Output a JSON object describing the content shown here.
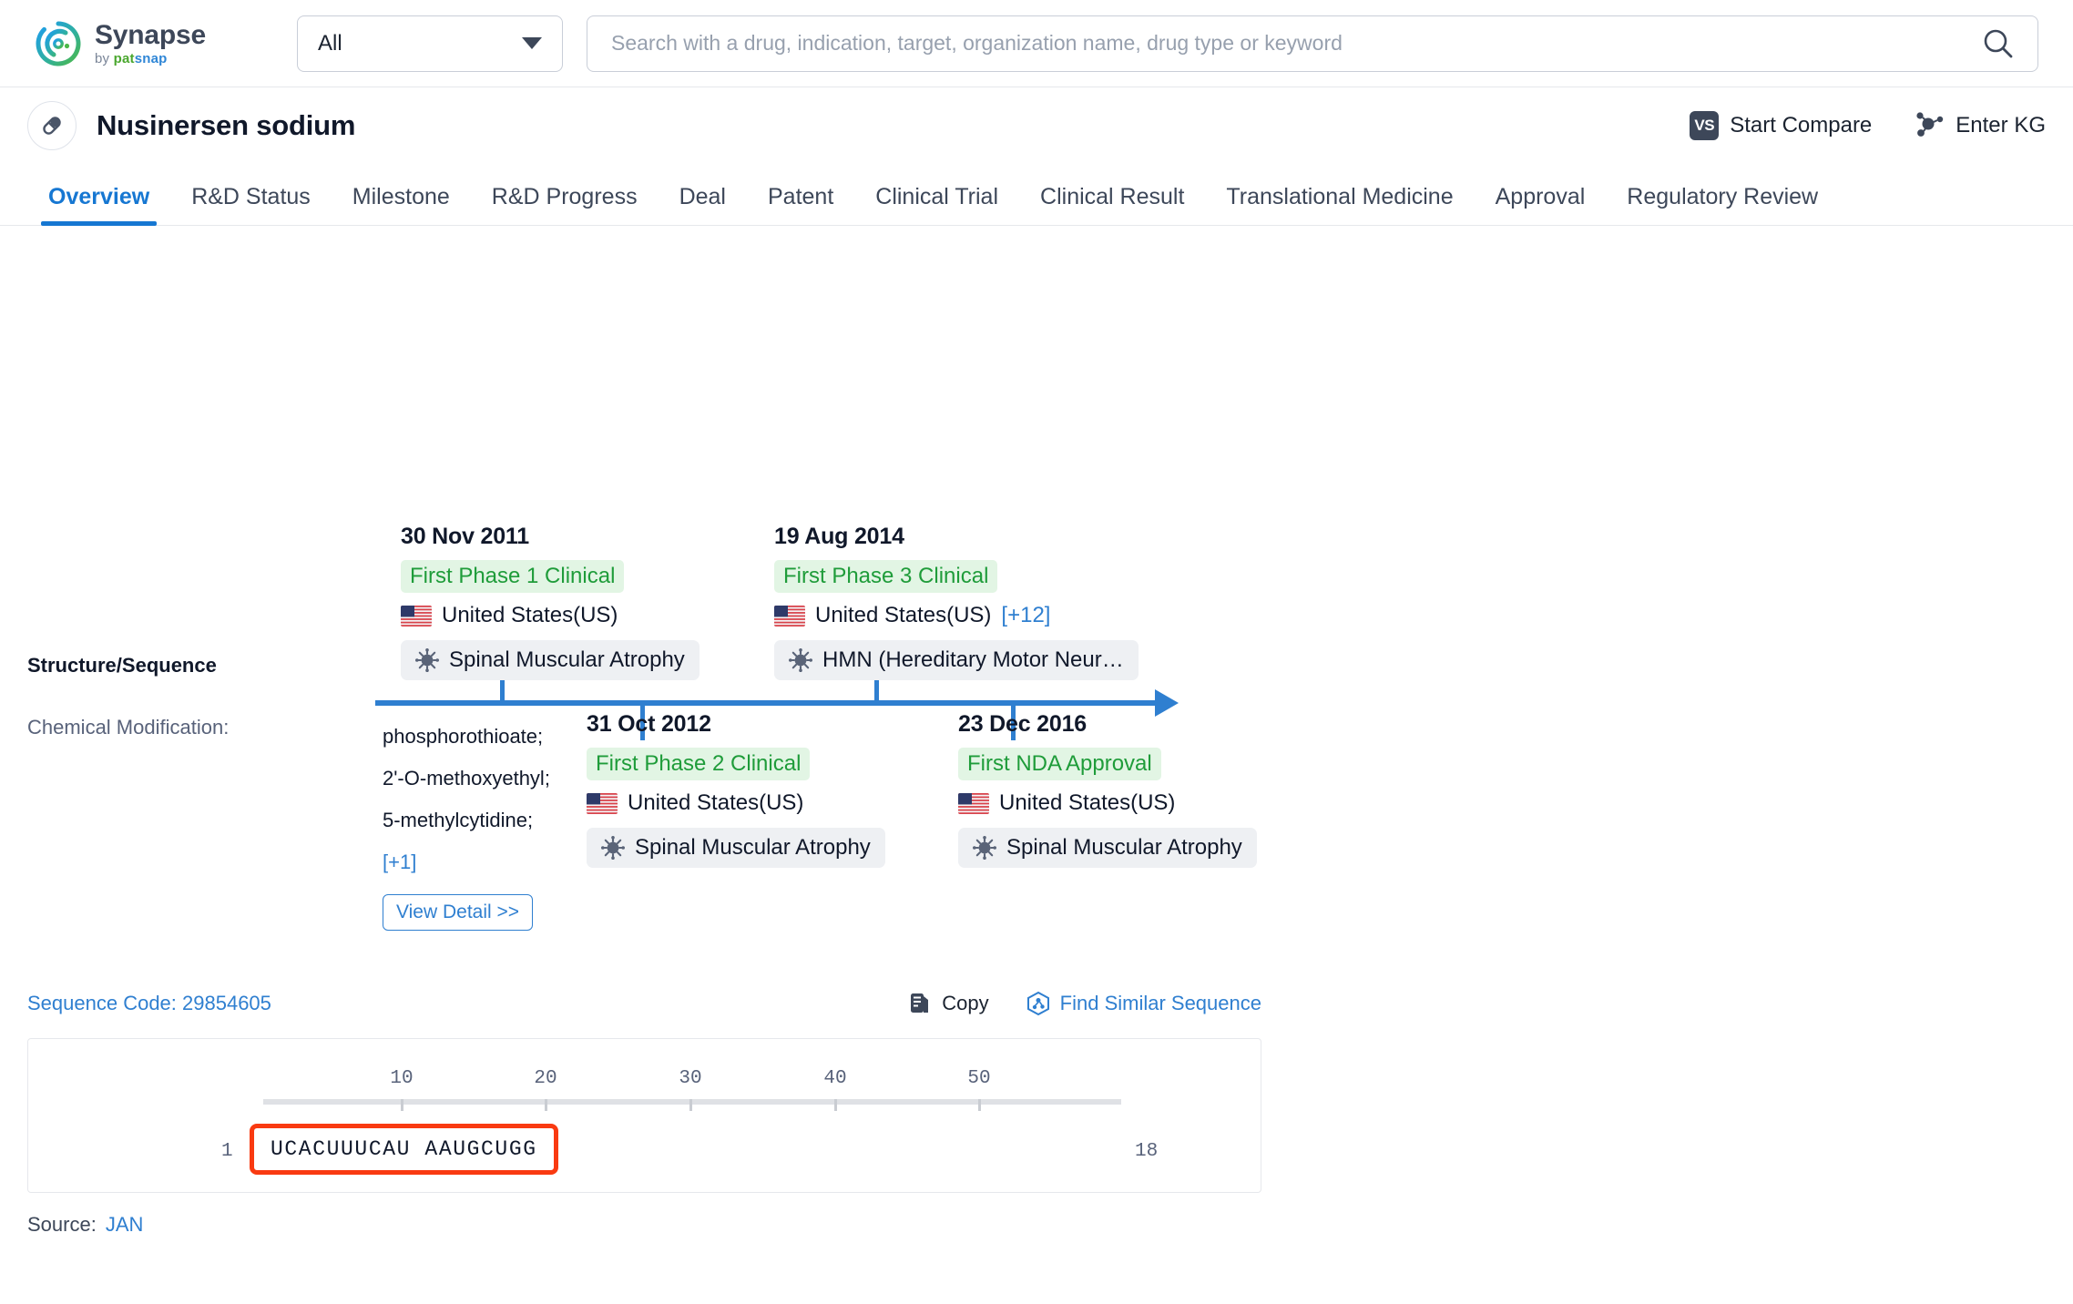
{
  "topbar": {
    "logo": {
      "word": "Synapse",
      "by": "by",
      "pat": "pat",
      "snap": "snap"
    },
    "scope": {
      "value": "All",
      "icon": "chevron-down-icon"
    },
    "search": {
      "placeholder": "Search with a drug, indication, target, organization name, drug type or keyword",
      "value": "",
      "icon": "search-icon"
    }
  },
  "drug_header": {
    "icon": "pill-icon",
    "title": "Nusinersen sodium",
    "actions": [
      {
        "label": "Start Compare",
        "icon": "vs-badge-icon",
        "badge": "VS"
      },
      {
        "label": "Enter KG",
        "icon": "knowledge-graph-icon"
      }
    ]
  },
  "tabs": [
    {
      "label": "Overview",
      "active": true
    },
    {
      "label": "R&D Status",
      "active": false
    },
    {
      "label": "Milestone",
      "active": false
    },
    {
      "label": "R&D Progress",
      "active": false
    },
    {
      "label": "Deal",
      "active": false
    },
    {
      "label": "Patent",
      "active": false
    },
    {
      "label": "Clinical Trial",
      "active": false
    },
    {
      "label": "Clinical Result",
      "active": false
    },
    {
      "label": "Translational Medicine",
      "active": false
    },
    {
      "label": "Approval",
      "active": false
    },
    {
      "label": "Regulatory Review",
      "active": false
    }
  ],
  "timeline": {
    "milestones": [
      {
        "date": "30 Nov 2011",
        "phase": "First Phase 1 Clinical",
        "country": "United States(US)",
        "country_more": "",
        "indication": "Spinal Muscular Atrophy",
        "position": "top"
      },
      {
        "date": "19 Aug 2014",
        "phase": "First Phase 3 Clinical",
        "country": "United States(US)",
        "country_more": "[+12]",
        "indication": "HMN (Hereditary Motor Neur…",
        "position": "top"
      },
      {
        "date": "31 Oct 2012",
        "phase": "First Phase 2 Clinical",
        "country": "United States(US)",
        "country_more": "",
        "indication": "Spinal Muscular Atrophy",
        "position": "bottom"
      },
      {
        "date": "23 Dec 2016",
        "phase": "First NDA Approval",
        "country": "United States(US)",
        "country_more": "",
        "indication": "Spinal Muscular Atrophy",
        "position": "bottom"
      }
    ]
  },
  "structure": {
    "section_title": "Structure/Sequence",
    "chem_mod_label": "Chemical Modification:",
    "chem_mods": [
      "phosphorothioate;",
      "2'-O-methoxyethyl;",
      "5-methylcytidine;"
    ],
    "chem_more": "[+1]",
    "view_detail": "View Detail >>"
  },
  "sequence": {
    "code_label": "Sequence Code: 29854605",
    "copy_label": "Copy",
    "find_similar_label": "Find Similar Sequence",
    "ruler_ticks": [
      10,
      20,
      30,
      40,
      50
    ],
    "start_index": "1",
    "end_index": "18",
    "sequence_text": "UCACUUUCAU AAUGCUGG",
    "highlight_color": "#f93a11"
  },
  "source": {
    "label": "Source:",
    "value": "JAN"
  },
  "colors": {
    "accent_blue": "#2f7fd0",
    "tab_active": "#1677d2",
    "phase_green": "#1f9c3a",
    "phase_green_bg": "#e2f5e4"
  }
}
